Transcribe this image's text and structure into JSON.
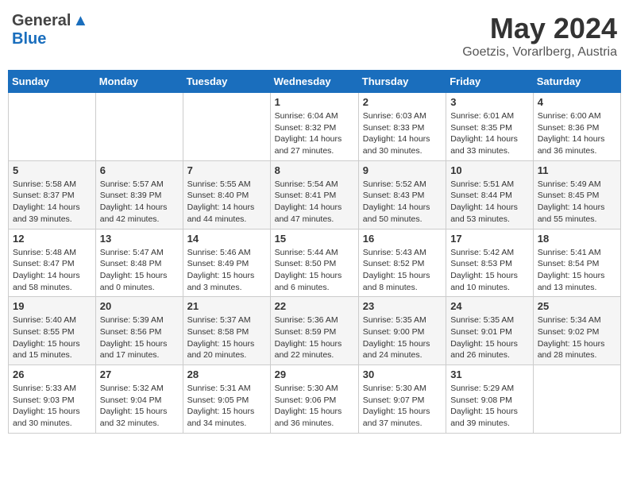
{
  "header": {
    "logo_general": "General",
    "logo_blue": "Blue",
    "month_title": "May 2024",
    "subtitle": "Goetzis, Vorarlberg, Austria"
  },
  "weekdays": [
    "Sunday",
    "Monday",
    "Tuesday",
    "Wednesday",
    "Thursday",
    "Friday",
    "Saturday"
  ],
  "weeks": [
    [
      {
        "day": "",
        "info": ""
      },
      {
        "day": "",
        "info": ""
      },
      {
        "day": "",
        "info": ""
      },
      {
        "day": "1",
        "info": "Sunrise: 6:04 AM\nSunset: 8:32 PM\nDaylight: 14 hours\nand 27 minutes."
      },
      {
        "day": "2",
        "info": "Sunrise: 6:03 AM\nSunset: 8:33 PM\nDaylight: 14 hours\nand 30 minutes."
      },
      {
        "day": "3",
        "info": "Sunrise: 6:01 AM\nSunset: 8:35 PM\nDaylight: 14 hours\nand 33 minutes."
      },
      {
        "day": "4",
        "info": "Sunrise: 6:00 AM\nSunset: 8:36 PM\nDaylight: 14 hours\nand 36 minutes."
      }
    ],
    [
      {
        "day": "5",
        "info": "Sunrise: 5:58 AM\nSunset: 8:37 PM\nDaylight: 14 hours\nand 39 minutes."
      },
      {
        "day": "6",
        "info": "Sunrise: 5:57 AM\nSunset: 8:39 PM\nDaylight: 14 hours\nand 42 minutes."
      },
      {
        "day": "7",
        "info": "Sunrise: 5:55 AM\nSunset: 8:40 PM\nDaylight: 14 hours\nand 44 minutes."
      },
      {
        "day": "8",
        "info": "Sunrise: 5:54 AM\nSunset: 8:41 PM\nDaylight: 14 hours\nand 47 minutes."
      },
      {
        "day": "9",
        "info": "Sunrise: 5:52 AM\nSunset: 8:43 PM\nDaylight: 14 hours\nand 50 minutes."
      },
      {
        "day": "10",
        "info": "Sunrise: 5:51 AM\nSunset: 8:44 PM\nDaylight: 14 hours\nand 53 minutes."
      },
      {
        "day": "11",
        "info": "Sunrise: 5:49 AM\nSunset: 8:45 PM\nDaylight: 14 hours\nand 55 minutes."
      }
    ],
    [
      {
        "day": "12",
        "info": "Sunrise: 5:48 AM\nSunset: 8:47 PM\nDaylight: 14 hours\nand 58 minutes."
      },
      {
        "day": "13",
        "info": "Sunrise: 5:47 AM\nSunset: 8:48 PM\nDaylight: 15 hours\nand 0 minutes."
      },
      {
        "day": "14",
        "info": "Sunrise: 5:46 AM\nSunset: 8:49 PM\nDaylight: 15 hours\nand 3 minutes."
      },
      {
        "day": "15",
        "info": "Sunrise: 5:44 AM\nSunset: 8:50 PM\nDaylight: 15 hours\nand 6 minutes."
      },
      {
        "day": "16",
        "info": "Sunrise: 5:43 AM\nSunset: 8:52 PM\nDaylight: 15 hours\nand 8 minutes."
      },
      {
        "day": "17",
        "info": "Sunrise: 5:42 AM\nSunset: 8:53 PM\nDaylight: 15 hours\nand 10 minutes."
      },
      {
        "day": "18",
        "info": "Sunrise: 5:41 AM\nSunset: 8:54 PM\nDaylight: 15 hours\nand 13 minutes."
      }
    ],
    [
      {
        "day": "19",
        "info": "Sunrise: 5:40 AM\nSunset: 8:55 PM\nDaylight: 15 hours\nand 15 minutes."
      },
      {
        "day": "20",
        "info": "Sunrise: 5:39 AM\nSunset: 8:56 PM\nDaylight: 15 hours\nand 17 minutes."
      },
      {
        "day": "21",
        "info": "Sunrise: 5:37 AM\nSunset: 8:58 PM\nDaylight: 15 hours\nand 20 minutes."
      },
      {
        "day": "22",
        "info": "Sunrise: 5:36 AM\nSunset: 8:59 PM\nDaylight: 15 hours\nand 22 minutes."
      },
      {
        "day": "23",
        "info": "Sunrise: 5:35 AM\nSunset: 9:00 PM\nDaylight: 15 hours\nand 24 minutes."
      },
      {
        "day": "24",
        "info": "Sunrise: 5:35 AM\nSunset: 9:01 PM\nDaylight: 15 hours\nand 26 minutes."
      },
      {
        "day": "25",
        "info": "Sunrise: 5:34 AM\nSunset: 9:02 PM\nDaylight: 15 hours\nand 28 minutes."
      }
    ],
    [
      {
        "day": "26",
        "info": "Sunrise: 5:33 AM\nSunset: 9:03 PM\nDaylight: 15 hours\nand 30 minutes."
      },
      {
        "day": "27",
        "info": "Sunrise: 5:32 AM\nSunset: 9:04 PM\nDaylight: 15 hours\nand 32 minutes."
      },
      {
        "day": "28",
        "info": "Sunrise: 5:31 AM\nSunset: 9:05 PM\nDaylight: 15 hours\nand 34 minutes."
      },
      {
        "day": "29",
        "info": "Sunrise: 5:30 AM\nSunset: 9:06 PM\nDaylight: 15 hours\nand 36 minutes."
      },
      {
        "day": "30",
        "info": "Sunrise: 5:30 AM\nSunset: 9:07 PM\nDaylight: 15 hours\nand 37 minutes."
      },
      {
        "day": "31",
        "info": "Sunrise: 5:29 AM\nSunset: 9:08 PM\nDaylight: 15 hours\nand 39 minutes."
      },
      {
        "day": "",
        "info": ""
      }
    ]
  ]
}
